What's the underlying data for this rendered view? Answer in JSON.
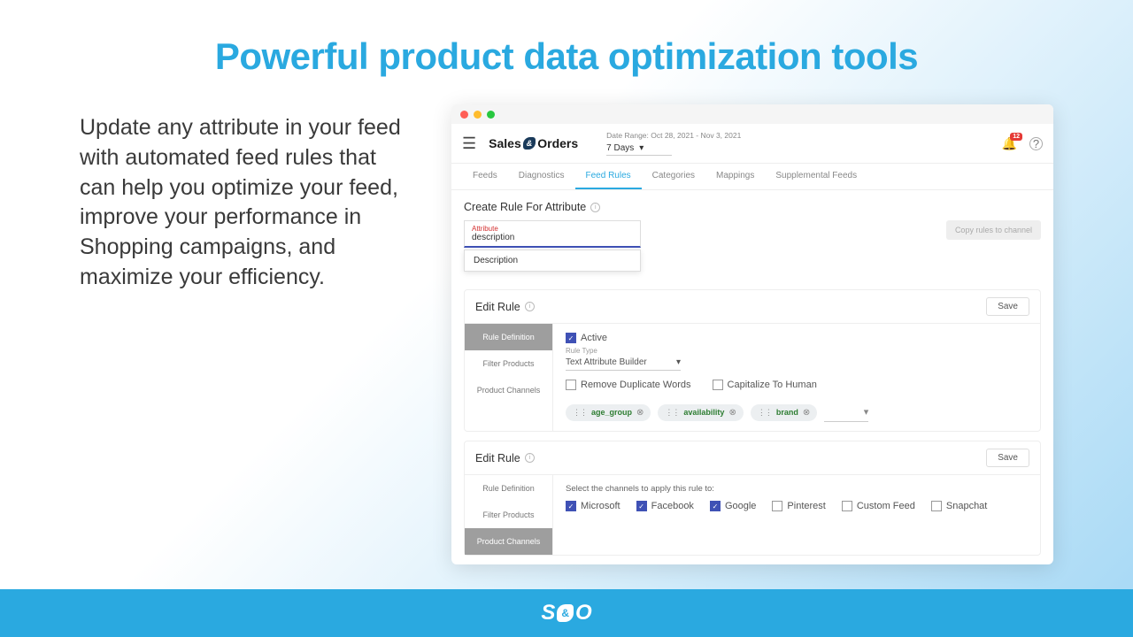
{
  "title": "Powerful product data optimization tools",
  "blurb": "Update any attribute in your feed with automated feed rules that can help you optimize your feed, improve your performance in Shopping campaigns, and maximize your efficiency.",
  "app": {
    "brand_left": "Sales",
    "brand_amp": "&",
    "brand_right": "Orders",
    "date_range_label": "Date Range: Oct 28, 2021 - Nov 3, 2021",
    "date_range_value": "7 Days",
    "notification_count": "12",
    "tabs": [
      "Feeds",
      "Diagnostics",
      "Feed Rules",
      "Categories",
      "Mappings",
      "Supplemental Feeds"
    ],
    "active_tab": "Feed Rules",
    "create_title": "Create Rule For Attribute",
    "attribute_label": "Attribute",
    "attribute_value": "description",
    "attribute_option": "Description",
    "copy_btn": "Copy rules to channel",
    "edit_rule_title": "Edit Rule",
    "save_btn": "Save",
    "side_tabs": [
      "Rule Definition",
      "Filter Products",
      "Product Channels"
    ],
    "active_label": "Active",
    "rule_type_label": "Rule Type",
    "rule_type_value": "Text Attribute Builder",
    "opt_remove_dup": "Remove Duplicate Words",
    "opt_capitalize": "Capitalize To Human",
    "chips": [
      "age_group",
      "availability",
      "brand"
    ],
    "channels_hint": "Select the channels to apply this rule to:",
    "channels": [
      {
        "name": "Microsoft",
        "checked": true
      },
      {
        "name": "Facebook",
        "checked": true
      },
      {
        "name": "Google",
        "checked": true
      },
      {
        "name": "Pinterest",
        "checked": false
      },
      {
        "name": "Custom Feed",
        "checked": false
      },
      {
        "name": "Snapchat",
        "checked": false
      }
    ]
  },
  "footer": {
    "left": "S",
    "amp": "&",
    "right": "O"
  }
}
